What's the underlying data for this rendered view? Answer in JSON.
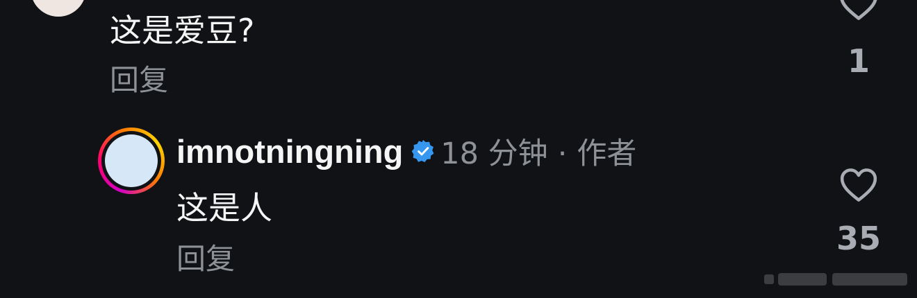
{
  "colors": {
    "background": "#101216",
    "text_primary": "#f5f5f5",
    "text_secondary": "#8e9196",
    "count": "#a9adb3",
    "verified_badge": "#3797f0"
  },
  "comments": [
    {
      "text": "这是爱豆?",
      "reply_label": "回复",
      "like_icon": "heart-outline-icon",
      "like_count": "1"
    },
    {
      "username": "imnotningning",
      "verified_icon": "verified-badge-icon",
      "time": "18 分钟",
      "separator": "·",
      "author_tag": "作者",
      "text": "这是人",
      "reply_label": "回复",
      "like_icon": "heart-outline-icon",
      "like_count": "35"
    }
  ]
}
